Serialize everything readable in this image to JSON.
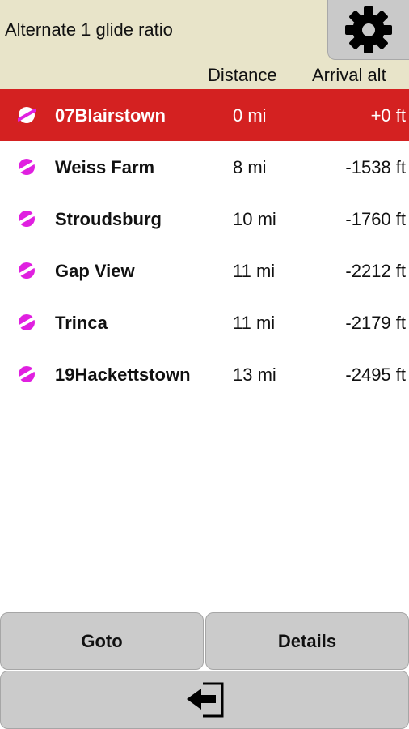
{
  "header": {
    "title": "Alternate 1 glide ratio",
    "settings_icon": "gear-icon",
    "columns": {
      "distance": "Distance",
      "arrival_alt": "Arrival alt"
    }
  },
  "waypoints": [
    {
      "name": "07Blairstown",
      "distance": "0 mi",
      "arrival_alt": "+0 ft",
      "selected": true,
      "icon": "airfield-icon"
    },
    {
      "name": "Weiss Farm",
      "distance": "8 mi",
      "arrival_alt": "-1538 ft",
      "selected": false,
      "icon": "airfield-icon"
    },
    {
      "name": "Stroudsburg",
      "distance": "10 mi",
      "arrival_alt": "-1760 ft",
      "selected": false,
      "icon": "airfield-icon"
    },
    {
      "name": "Gap View",
      "distance": "11 mi",
      "arrival_alt": "-2212 ft",
      "selected": false,
      "icon": "airfield-icon"
    },
    {
      "name": "Trinca",
      "distance": "11 mi",
      "arrival_alt": "-2179 ft",
      "selected": false,
      "icon": "airfield-icon"
    },
    {
      "name": "19Hackettstown",
      "distance": "13 mi",
      "arrival_alt": "-2495 ft",
      "selected": false,
      "icon": "airfield-icon"
    }
  ],
  "footer": {
    "goto_label": "Goto",
    "details_label": "Details",
    "exit_icon": "exit-icon"
  },
  "colors": {
    "header_bg": "#e8e4c9",
    "selected_row": "#d42121",
    "airfield_icon": "#e020e0",
    "button_bg": "#cbcbcb"
  }
}
